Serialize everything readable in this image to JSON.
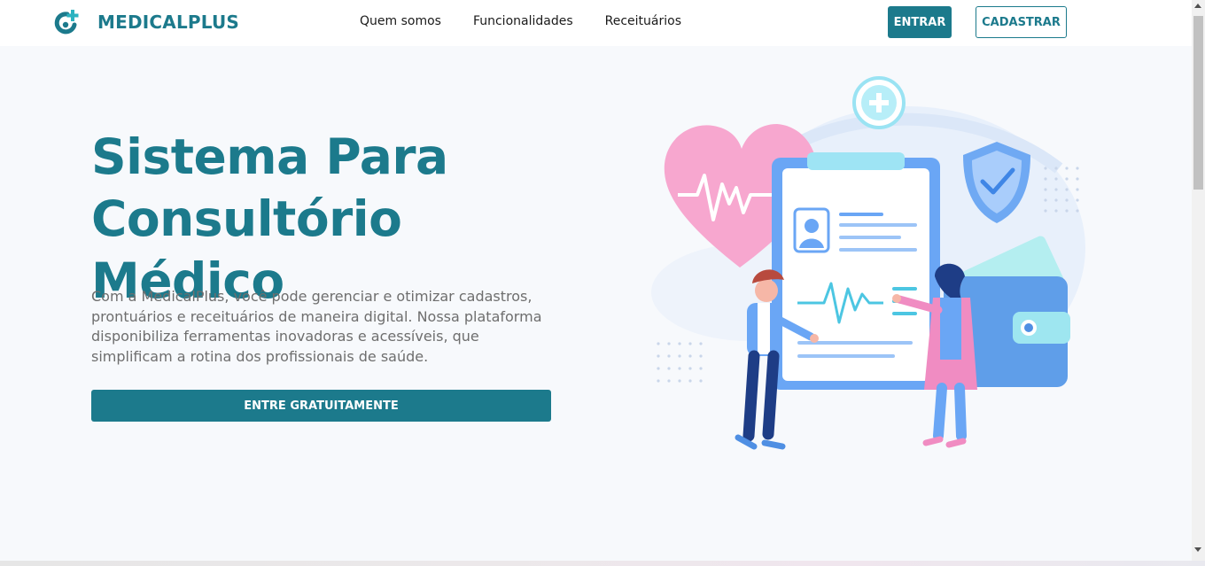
{
  "brand": {
    "name": "MEDICALPLUS",
    "color": "#1c7a8c"
  },
  "nav": {
    "links": [
      "Quem somos",
      "Funcionalidades",
      "Receituários"
    ],
    "login_label": "ENTRAR",
    "signup_label": "CADASTRAR"
  },
  "hero": {
    "title_line1": "Sistema Para",
    "title_line2": "Consultório Médico",
    "description": "Com a MedicalPlus, você pode gerenciar e otimizar cadastros, prontuários e receituários de maneira digital. Nossa plataforma disponibiliza ferramentas inovadoras e acessíveis, que simplificam a rotina dos profissionais de saúde.",
    "cta_label": "ENTRE GRATUITAMENTE"
  },
  "illustration": {
    "icon": "medical-clipboard-illustration"
  },
  "colors": {
    "accent": "#1c7a8c",
    "background": "#f7f9fc",
    "text_muted": "#6e6e6e"
  }
}
